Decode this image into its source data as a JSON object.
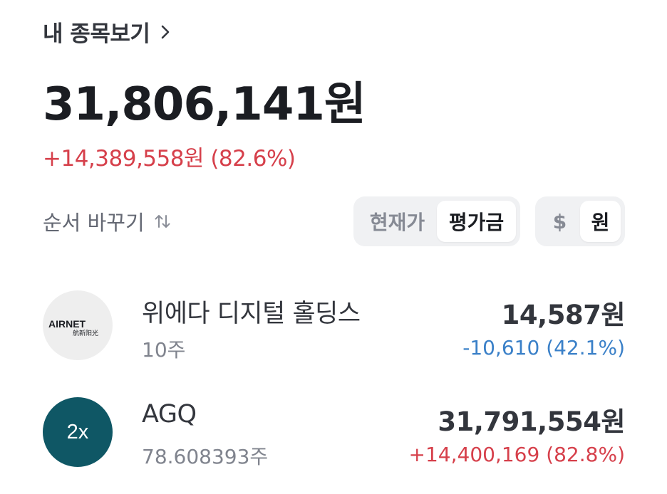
{
  "header": {
    "title": "내 종목보기"
  },
  "summary": {
    "total": "31,806,141원",
    "gain": "+14,389,558원 (82.6%)"
  },
  "sort": {
    "label": "순서 바꾸기"
  },
  "price_toggle": {
    "options": [
      "현재가",
      "평가금"
    ],
    "selected": "평가금"
  },
  "currency_toggle": {
    "options": [
      "$",
      "원"
    ],
    "selected": "원"
  },
  "holdings": [
    {
      "name": "위에다 디지털 홀딩스",
      "quantity": "10주",
      "value": "14,587원",
      "change": "-10,610 (42.1%)",
      "direction": "down",
      "logo": {
        "type": "image",
        "text": "AIRNET",
        "subtext": "航新阳光"
      }
    },
    {
      "name": "AGQ",
      "quantity": "78.608393주",
      "value": "31,791,554원",
      "change": "+14,400,169 (82.8%)",
      "direction": "up",
      "logo": {
        "type": "badge",
        "text": "2x",
        "color": "#0f5765"
      }
    }
  ],
  "colors": {
    "up": "#d6404b",
    "down": "#3a80c8",
    "segment_bg": "#f0f1f3"
  }
}
